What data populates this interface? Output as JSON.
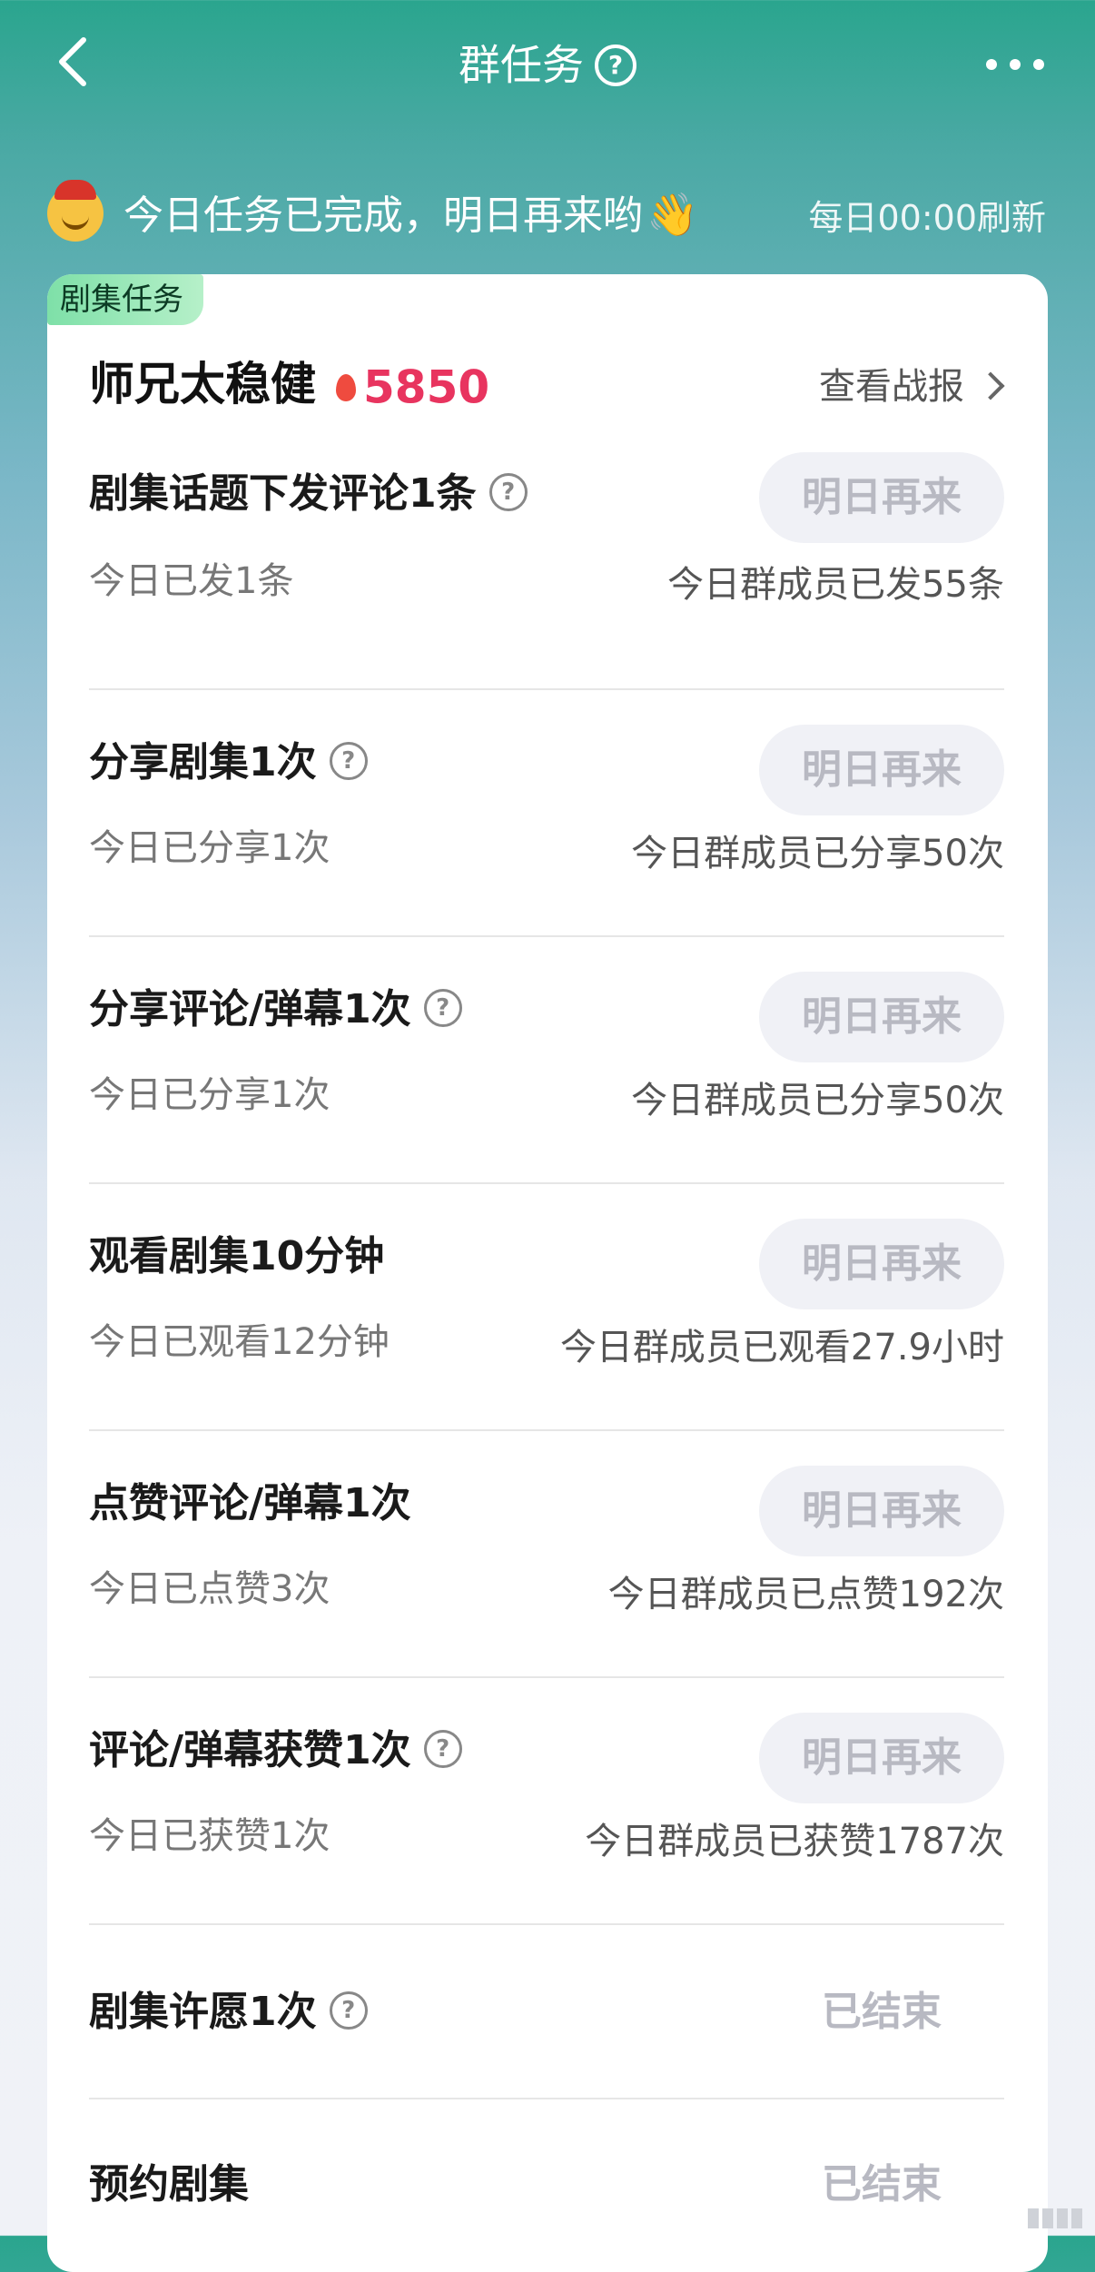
{
  "header": {
    "title": "群任务",
    "help_glyph": "?"
  },
  "notice": {
    "text": "今日任务已完成，明日再来哟",
    "refresh": "每日00:00刷新"
  },
  "card": {
    "tag": "剧集任务",
    "drama_title": "师兄太稳健",
    "heat": "5850",
    "report_link": "查看战报"
  },
  "tasks": [
    {
      "title": "剧集话题下发评论1条",
      "button": "明日再来",
      "mine": "今日已发1条",
      "group": "今日群成员已发55条"
    },
    {
      "title": "分享剧集1次",
      "button": "明日再来",
      "mine": "今日已分享1次",
      "group": "今日群成员已分享50次"
    },
    {
      "title": "分享评论/弹幕1次",
      "button": "明日再来",
      "mine": "今日已分享1次",
      "group": "今日群成员已分享50次"
    },
    {
      "title": "观看剧集10分钟",
      "button": "明日再来",
      "mine": "今日已观看12分钟",
      "group": "今日群成员已观看27.9小时"
    },
    {
      "title": "点赞评论/弹幕1次",
      "button": "明日再来",
      "mine": "今日已点赞3次",
      "group": "今日群成员已点赞192次"
    },
    {
      "title": "评论/弹幕获赞1次",
      "button": "明日再来",
      "mine": "今日已获赞1次",
      "group": "今日群成员已获赞1787次"
    },
    {
      "title": "剧集许愿1次",
      "button": "已结束"
    },
    {
      "title": "预约剧集",
      "button": "已结束"
    }
  ],
  "icons": {
    "back": "chevron-left-icon",
    "help": "question-circle-icon",
    "more": "more-dots-icon",
    "flame": "flame-icon",
    "report_arrow": "chevron-right-icon"
  },
  "colors": {
    "heat": "#e8345f",
    "tag_bg": "#9de8b9",
    "button_bg": "#f0f1f6",
    "button_text": "#b8b9c2"
  }
}
